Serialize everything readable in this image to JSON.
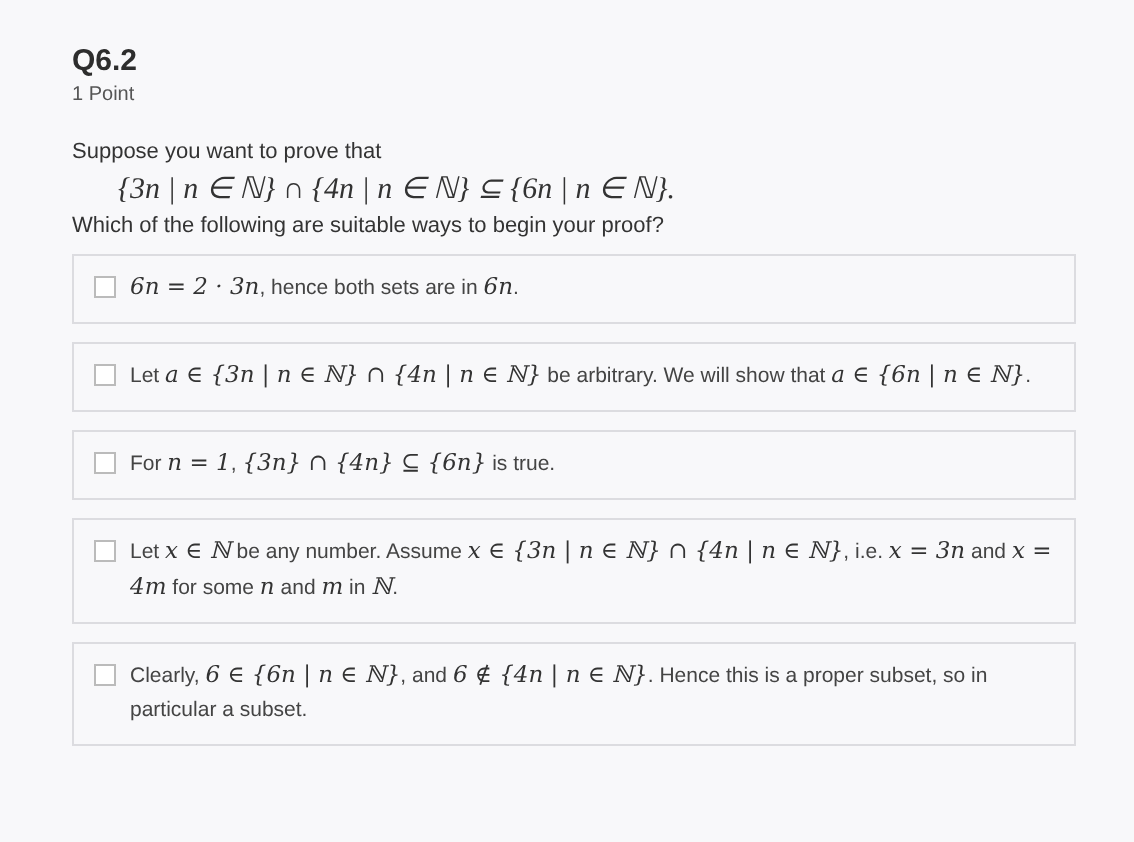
{
  "question": {
    "title": "Q6.2",
    "points": "1 Point",
    "prompt": "Suppose you want to prove that",
    "formula": "{3n | n ∈ ℕ} ∩ {4n | n ∈ ℕ} ⊆ {6n | n ∈ ℕ}.",
    "instruction": "Which of the following are suitable ways to begin your proof?"
  },
  "options": [
    {
      "checked": false,
      "parts": [
        {
          "kind": "math",
          "text": "6n = 2 · 3n"
        },
        {
          "kind": "text",
          "text": ", hence both sets are in "
        },
        {
          "kind": "math",
          "text": "6n"
        },
        {
          "kind": "text",
          "text": "."
        }
      ]
    },
    {
      "checked": false,
      "parts": [
        {
          "kind": "text",
          "text": "Let "
        },
        {
          "kind": "math",
          "text": "a ∈ {3n | n ∈ ℕ} ∩ {4n | n ∈ ℕ}"
        },
        {
          "kind": "text",
          "text": " be arbitrary. We will show that "
        },
        {
          "kind": "math",
          "text": "a ∈ {6n | n ∈ ℕ}"
        },
        {
          "kind": "text",
          "text": "."
        }
      ]
    },
    {
      "checked": false,
      "parts": [
        {
          "kind": "text",
          "text": "For "
        },
        {
          "kind": "math",
          "text": "n = 1"
        },
        {
          "kind": "text",
          "text": ", "
        },
        {
          "kind": "math",
          "text": "{3n} ∩ {4n} ⊆ {6n}"
        },
        {
          "kind": "text",
          "text": " is true."
        }
      ]
    },
    {
      "checked": false,
      "parts": [
        {
          "kind": "text",
          "text": "Let "
        },
        {
          "kind": "math",
          "text": "x ∈ ℕ"
        },
        {
          "kind": "text",
          "text": " be any number. Assume "
        },
        {
          "kind": "math",
          "text": "x ∈ {3n | n ∈ ℕ} ∩ {4n | n ∈ ℕ}"
        },
        {
          "kind": "text",
          "text": ", i.e. "
        },
        {
          "kind": "math",
          "text": "x = 3n"
        },
        {
          "kind": "text",
          "text": " and "
        },
        {
          "kind": "math",
          "text": "x = 4m"
        },
        {
          "kind": "text",
          "text": " for some "
        },
        {
          "kind": "math",
          "text": "n"
        },
        {
          "kind": "text",
          "text": " and "
        },
        {
          "kind": "math",
          "text": "m"
        },
        {
          "kind": "text",
          "text": " in "
        },
        {
          "kind": "math",
          "text": "ℕ"
        },
        {
          "kind": "text",
          "text": "."
        }
      ]
    },
    {
      "checked": false,
      "parts": [
        {
          "kind": "text",
          "text": "Clearly, "
        },
        {
          "kind": "math",
          "text": "6 ∈ {6n | n ∈ ℕ}"
        },
        {
          "kind": "text",
          "text": ", and "
        },
        {
          "kind": "math",
          "text": "6 ∉ {4n | n ∈ ℕ}"
        },
        {
          "kind": "text",
          "text": ". Hence this is a proper subset, so in particular a subset."
        }
      ]
    }
  ]
}
